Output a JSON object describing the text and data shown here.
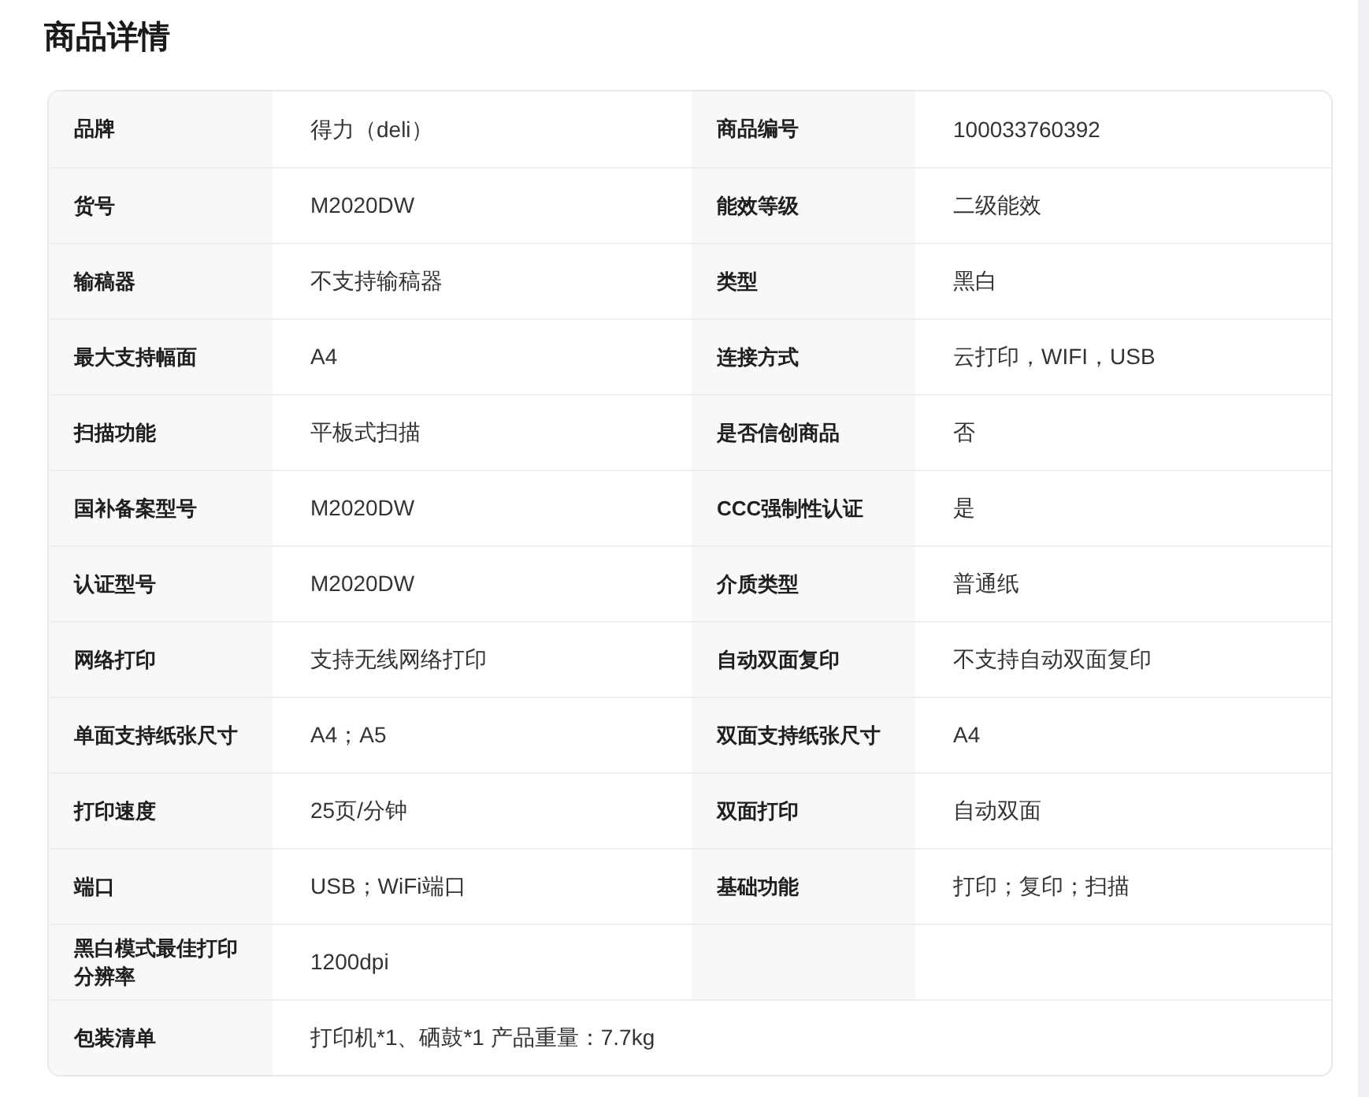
{
  "title": "商品详情",
  "rows": [
    {
      "cells": [
        {
          "label": "品牌",
          "value": "得力（deli）"
        },
        {
          "label": "商品编号",
          "value": "100033760392"
        }
      ]
    },
    {
      "cells": [
        {
          "label": "货号",
          "value": "M2020DW"
        },
        {
          "label": "能效等级",
          "value": "二级能效"
        }
      ]
    },
    {
      "cells": [
        {
          "label": "输稿器",
          "value": "不支持输稿器"
        },
        {
          "label": "类型",
          "value": "黑白"
        }
      ]
    },
    {
      "cells": [
        {
          "label": "最大支持幅面",
          "value": "A4"
        },
        {
          "label": "连接方式",
          "value": "云打印，WIFI，USB"
        }
      ]
    },
    {
      "cells": [
        {
          "label": "扫描功能",
          "value": "平板式扫描"
        },
        {
          "label": "是否信创商品",
          "value": "否"
        }
      ]
    },
    {
      "cells": [
        {
          "label": "国补备案型号",
          "value": "M2020DW"
        },
        {
          "label": "CCC强制性认证",
          "value": "是"
        }
      ]
    },
    {
      "cells": [
        {
          "label": "认证型号",
          "value": "M2020DW"
        },
        {
          "label": "介质类型",
          "value": "普通纸"
        }
      ]
    },
    {
      "cells": [
        {
          "label": "网络打印",
          "value": "支持无线网络打印"
        },
        {
          "label": "自动双面复印",
          "value": "不支持自动双面复印"
        }
      ]
    },
    {
      "cells": [
        {
          "label": "单面支持纸张尺寸",
          "value": "A4；A5"
        },
        {
          "label": "双面支持纸张尺寸",
          "value": "A4"
        }
      ]
    },
    {
      "cells": [
        {
          "label": "打印速度",
          "value": "25页/分钟"
        },
        {
          "label": "双面打印",
          "value": "自动双面"
        }
      ]
    },
    {
      "cells": [
        {
          "label": "端口",
          "value": "USB；WiFi端口"
        },
        {
          "label": "基础功能",
          "value": "打印；复印；扫描"
        }
      ]
    },
    {
      "cells": [
        {
          "label": "黑白模式最佳打印分辨率",
          "value": "1200dpi"
        }
      ]
    },
    {
      "wide": true,
      "cells": [
        {
          "label": "包装清单",
          "value": "打印机*1、硒鼓*1 产品重量：7.7kg"
        }
      ]
    }
  ]
}
